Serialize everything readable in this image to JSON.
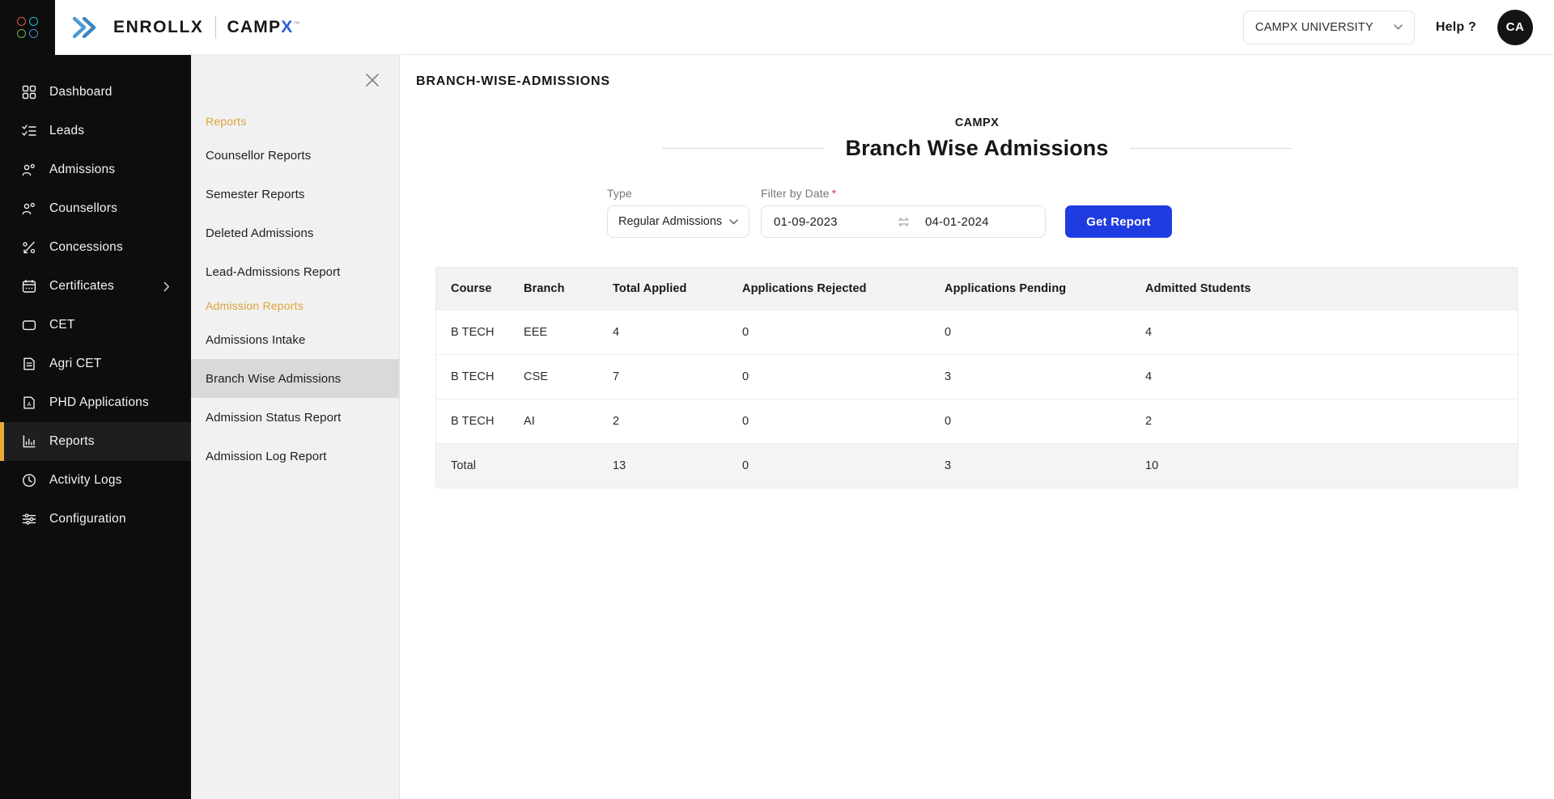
{
  "topbar": {
    "logo_icon": "grid-dots-icon",
    "brand_chevron_icon": "double-chevron-icon",
    "brand_primary": "ENROLLX",
    "brand_secondary": "CAMP",
    "brand_secondary_accent": "X",
    "brand_trademark": "™",
    "university_select": {
      "value": "CAMPX UNIVERSITY",
      "chevron_icon": "chevron-down-icon"
    },
    "help_label": "Help ?",
    "avatar_initials": "CA"
  },
  "sidebar": {
    "items": [
      {
        "label": "Dashboard",
        "icon": "grid-squares-icon",
        "active": false,
        "has_submenu": false
      },
      {
        "label": "Leads",
        "icon": "checklist-icon",
        "active": false,
        "has_submenu": false
      },
      {
        "label": "Admissions",
        "icon": "users-icon",
        "active": false,
        "has_submenu": false
      },
      {
        "label": "Counsellors",
        "icon": "users-icon",
        "active": false,
        "has_submenu": false
      },
      {
        "label": "Concessions",
        "icon": "percent-arrow-icon",
        "active": false,
        "has_submenu": false
      },
      {
        "label": "Certificates",
        "icon": "calendar-icon",
        "active": false,
        "has_submenu": true
      },
      {
        "label": "CET",
        "icon": "square-icon",
        "active": false,
        "has_submenu": false
      },
      {
        "label": "Agri CET",
        "icon": "document-lines-icon",
        "active": false,
        "has_submenu": false
      },
      {
        "label": "PHD Applications",
        "icon": "document-a-icon",
        "active": false,
        "has_submenu": false
      },
      {
        "label": "Reports",
        "icon": "bar-chart-icon",
        "active": true,
        "has_submenu": false
      },
      {
        "label": "Activity Logs",
        "icon": "clock-icon",
        "active": false,
        "has_submenu": false
      },
      {
        "label": "Configuration",
        "icon": "sliders-icon",
        "active": false,
        "has_submenu": false
      }
    ]
  },
  "submenu": {
    "close_icon": "close-icon",
    "groups": [
      {
        "title": "Reports",
        "items": [
          {
            "label": "Counsellor Reports",
            "active": false
          },
          {
            "label": "Semester Reports",
            "active": false
          },
          {
            "label": "Deleted Admissions",
            "active": false
          },
          {
            "label": "Lead-Admissions Report",
            "active": false
          }
        ]
      },
      {
        "title": "Admission Reports",
        "items": [
          {
            "label": "Admissions Intake",
            "active": false
          },
          {
            "label": "Branch Wise Admissions",
            "active": true
          },
          {
            "label": "Admission Status Report",
            "active": false
          },
          {
            "label": "Admission Log Report",
            "active": false
          }
        ]
      }
    ]
  },
  "main": {
    "page_title": "BRANCH-WISE-ADMISSIONS",
    "report_org": "CAMPX",
    "report_title": "Branch Wise Admissions",
    "controls": {
      "type_label": "Type",
      "type_value": "Regular Admissions",
      "type_chevron_icon": "chevron-down-icon",
      "date_label": "Filter by Date",
      "date_required_marker": "*",
      "date_from": "01-09-2023",
      "date_to": "04-01-2024",
      "date_swap_icon": "swap-arrows-icon",
      "get_report_label": "Get Report"
    },
    "table": {
      "columns": [
        "Course",
        "Branch",
        "Total Applied",
        "Applications Rejected",
        "Applications Pending",
        "Admitted Students"
      ],
      "rows": [
        {
          "cells": [
            "B TECH",
            "EEE",
            "4",
            "0",
            "0",
            "4"
          ],
          "is_total": false
        },
        {
          "cells": [
            "B TECH",
            "CSE",
            "7",
            "0",
            "3",
            "4"
          ],
          "is_total": false
        },
        {
          "cells": [
            "B TECH",
            "AI",
            "2",
            "0",
            "0",
            "2"
          ],
          "is_total": false
        },
        {
          "cells": [
            "Total",
            "",
            "13",
            "0",
            "3",
            "10"
          ],
          "is_total": true
        }
      ]
    }
  },
  "colors": {
    "sidebar_bg": "#0d0d0d",
    "active_marker": "#eaa83c",
    "submenu_bg": "#f1f1f1",
    "submenu_active": "#d9d9d9",
    "group_heading": "#e0a23b",
    "primary_button": "#1f3ce0",
    "required_marker": "#d13b3b",
    "brand_accent": "#2b60d9"
  }
}
